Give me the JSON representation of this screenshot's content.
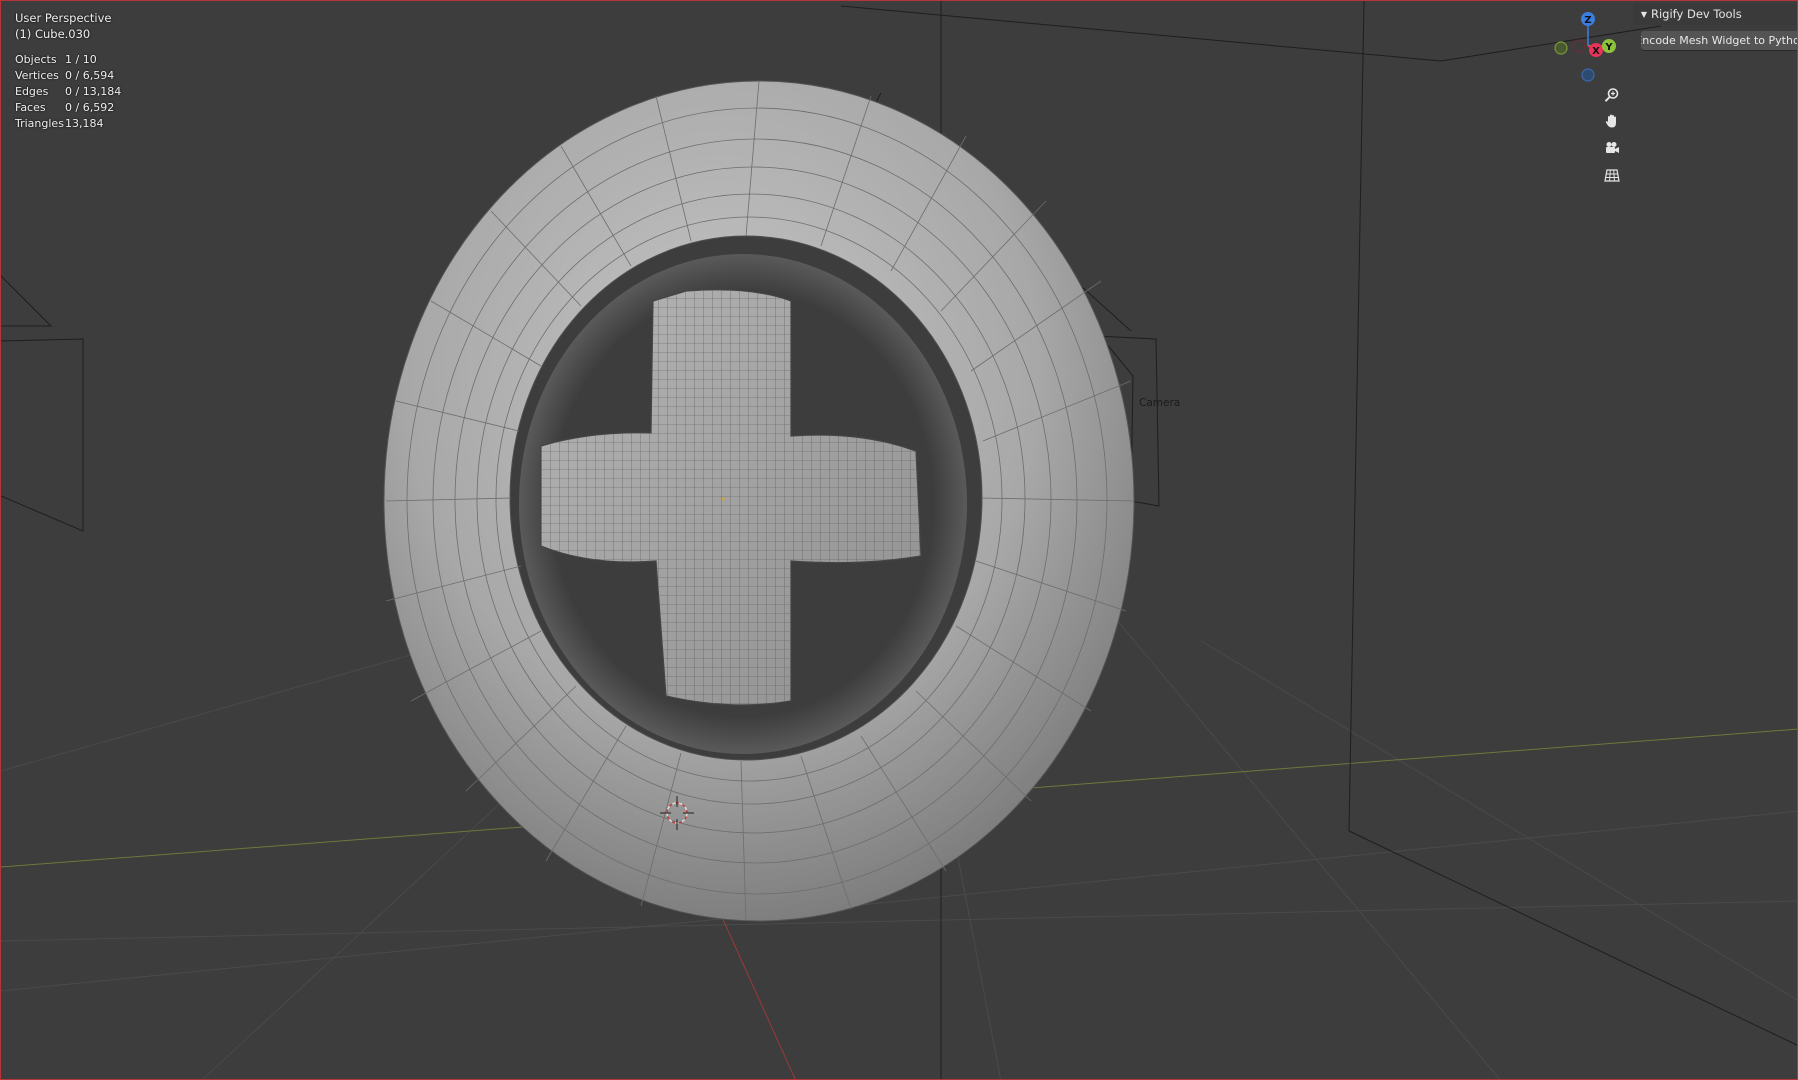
{
  "viewport": {
    "view_name": "User Perspective",
    "active_object": "(1) Cube.030",
    "camera_label": "Camera"
  },
  "stats": [
    {
      "label": "Objects",
      "value": "1 / 10"
    },
    {
      "label": "Vertices",
      "value": "0 / 6,594"
    },
    {
      "label": "Edges",
      "value": "0 / 13,184"
    },
    {
      "label": "Faces",
      "value": "0 / 6,592"
    },
    {
      "label": "Triangles",
      "value": "13,184"
    }
  ],
  "gizmo": {
    "axis_z": "Z",
    "axis_x": "X",
    "axis_y": "Y",
    "colors": {
      "x": "#e8345a",
      "y": "#8bc33a",
      "z": "#3a7ee0"
    }
  },
  "nav_icons": [
    "zoom-icon",
    "pan-hand-icon",
    "camera-view-icon",
    "ortho-grid-icon"
  ],
  "sidebar": {
    "panel_title": "Rigify Dev Tools",
    "encode_button_label": "Encode Mesh Widget to Python"
  },
  "colors": {
    "background": "#3d3d3d",
    "active_border": "#b8333a",
    "mesh": "#a9a9a9"
  }
}
